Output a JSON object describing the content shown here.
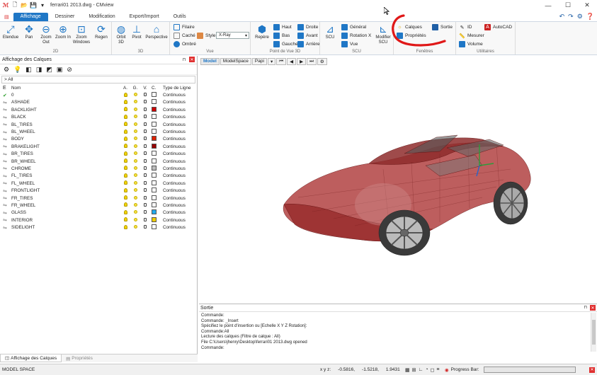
{
  "window": {
    "title": "ferrari01 2013.dwg - CMview",
    "minimize": "—",
    "maximize": "☐",
    "close": "✕"
  },
  "tabs": [
    "Affichage",
    "Dessiner",
    "Modification",
    "Export/Import",
    "Outils"
  ],
  "ribbon": {
    "navigation": {
      "label": "2D",
      "buttons": [
        "Etendue",
        "Pan",
        "Zoom Out",
        "Zoom In",
        "Zoom Windows",
        "Regen"
      ]
    },
    "view3d": {
      "label": "3D",
      "buttons": [
        "Orbit 3D",
        "Pivot",
        "Perspective"
      ]
    },
    "vue": {
      "label": "Vue",
      "items": [
        "Filaire",
        "Caché",
        "Ombré"
      ],
      "style_label": "Style",
      "style_value": "X-Ray"
    },
    "pointdevue": {
      "label": "Point de Vue 3D",
      "big": "Repère",
      "items": [
        "Haut",
        "Bas",
        "Gauche",
        "Droite",
        "Avant",
        "Arrière"
      ]
    },
    "scu": {
      "label": "SCU",
      "big": "SCU",
      "items": [
        "Général",
        "Rotation X",
        "Vue"
      ],
      "big2": "Modifier SCU"
    },
    "fenetres": {
      "label": "Fenêtres",
      "items": [
        "Calques",
        "Propriétés",
        "Sortie"
      ]
    },
    "utilitaires": {
      "label": "Utilitaires",
      "items": [
        "ID",
        "Mesurer",
        "Volume",
        "AutoCAD"
      ]
    }
  },
  "layers_panel": {
    "title": "Affichage des Calques",
    "filter": "> All",
    "columns": [
      "E",
      "Nom",
      "A.",
      "G.",
      "V.",
      "C.",
      "Type de Ligne"
    ],
    "rows": [
      {
        "name": "0",
        "color": "#ffffff",
        "current": true
      },
      {
        "name": "ASHADE",
        "color": "#ffffff"
      },
      {
        "name": "BACKLIGHT",
        "color": "#cc0000"
      },
      {
        "name": "BLACK",
        "color": "#ffffff"
      },
      {
        "name": "BL_TIRES",
        "color": "#ffffff"
      },
      {
        "name": "BL_WHEEL",
        "color": "#ffffff"
      },
      {
        "name": "BODY",
        "color": "#dd2200"
      },
      {
        "name": "BRAKELIGHT",
        "color": "#990000"
      },
      {
        "name": "BR_TIRES",
        "color": "#ffffff"
      },
      {
        "name": "BR_WHEEL",
        "color": "#ffffff"
      },
      {
        "name": "CHROME",
        "color": "#bbbbbb"
      },
      {
        "name": "FL_TIRES",
        "color": "#ffffff"
      },
      {
        "name": "FL_WHEEL",
        "color": "#ffffff"
      },
      {
        "name": "FRONTLIGHT",
        "color": "#ffffff"
      },
      {
        "name": "FR_TIRES",
        "color": "#ffffff"
      },
      {
        "name": "FR_WHEEL",
        "color": "#ffffff"
      },
      {
        "name": "GLASS",
        "color": "#22aaee"
      },
      {
        "name": "INTERIOR",
        "color": "#eecc00"
      },
      {
        "name": "SIDELIGHT",
        "color": "#ffffff"
      }
    ],
    "linetype": "Continuous",
    "bottom_tabs": [
      "Affichage des Calques",
      "Propriétés"
    ]
  },
  "viewport": {
    "tabs": [
      "Model",
      "ModelSpace",
      "Papi"
    ]
  },
  "output": {
    "title": "Sortie",
    "lines": [
      "Commande:",
      "Commande: _Insert",
      "Spécifiez le point d'insertion ou [Echelle X Y Z Rotation]:",
      "Commande:All",
      "Lecture des calques (Filtre de calque : All)",
      "File C:\\Users\\jhenry\\Desktop\\ferrari01 2013.dwg opened",
      "Commande:"
    ]
  },
  "status": {
    "space": "MODEL SPACE",
    "xyz_label": "x y z:",
    "x": "-0.5816,",
    "y": "-1.5218,",
    "z": "1.9431",
    "progress_label": "Progress Bar:"
  }
}
